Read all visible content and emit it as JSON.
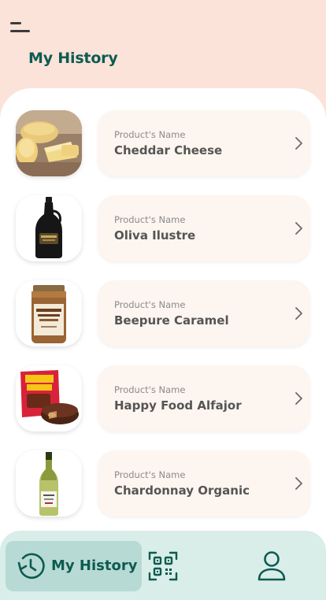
{
  "header": {
    "menu_icon": "hamburger-menu-icon",
    "title": "My History"
  },
  "products": [
    {
      "label": "Product's Name",
      "name": "Cheddar Cheese",
      "image": "cheddar-cheese-image"
    },
    {
      "label": "Product's Name",
      "name": "Oliva Ilustre",
      "image": "olive-oil-bottle-image"
    },
    {
      "label": "Product's Name",
      "name": "Beepure Caramel",
      "image": "caramel-jar-image"
    },
    {
      "label": "Product's Name",
      "name": "Happy Food Alfajor",
      "image": "alfajor-image"
    },
    {
      "label": "Product's Name",
      "name": "Chardonnay Organic",
      "image": "wine-bottle-image"
    }
  ],
  "tabbar": {
    "history_label": "My History",
    "history_icon": "clock-history-icon",
    "scan_icon": "qr-scan-icon",
    "profile_icon": "user-profile-icon"
  },
  "colors": {
    "header_bg": "#fbe3d9",
    "accent": "#0e5b50",
    "card_bg": "#fdf5ef",
    "tabbar_bg": "#d9ede9",
    "tab_active_bg": "#b7dbd4"
  }
}
